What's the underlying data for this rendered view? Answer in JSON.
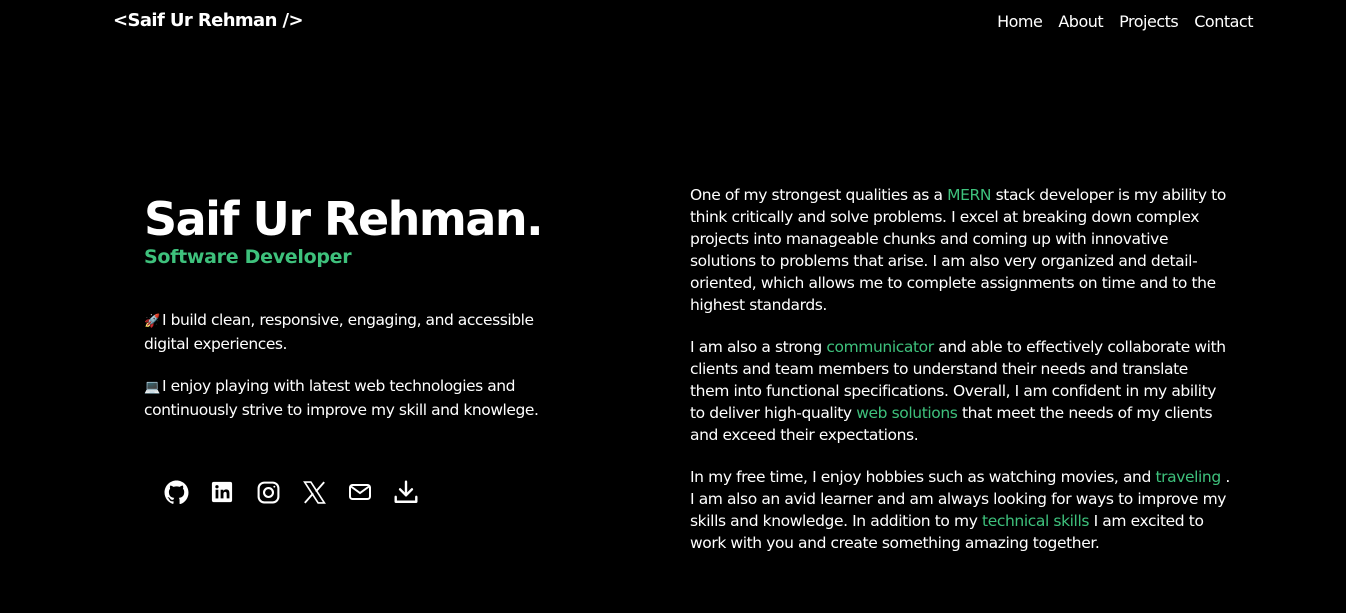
{
  "nav": {
    "brand": "<Saif Ur Rehman />",
    "links": [
      "Home",
      "About",
      "Projects",
      "Contact"
    ]
  },
  "hero": {
    "name": "Saif Ur Rehman.",
    "role": "Software Developer",
    "line1_emoji": "🚀",
    "line1": "I build clean, responsive, engaging, and accessible digital experiences.",
    "line2_emoji": "💻",
    "line2": "I enjoy playing with latest web technologies and continuously strive to improve my skill and knowlege."
  },
  "socials": {
    "icons": [
      "github-icon",
      "linkedin-icon",
      "instagram-icon",
      "x-icon",
      "mail-icon",
      "download-icon"
    ]
  },
  "about": {
    "p1": {
      "before": "One of my strongest qualities as a ",
      "highlight": "MERN",
      "after": " stack developer is my ability to think critically and solve problems. I excel at breaking down complex projects into manageable chunks and coming up with innovative solutions to problems that arise. I am also very organized and detail-oriented, which allows me to complete assignments on time and to the highest standards."
    },
    "p2": {
      "before": "I am also a strong ",
      "highlight1": "communicator",
      "middle": " and able to effectively collaborate with clients and team members to understand their needs and translate them into functional specifications. Overall, I am confident in my ability to deliver high-quality ",
      "highlight2": "web solutions",
      "after": " that meet the needs of my clients and exceed their expectations."
    },
    "p3": {
      "before": "In my free time, I enjoy hobbies such as watching movies, and ",
      "highlight1": "traveling",
      "middle": " . I am also an avid learner and am always looking for ways to improve my skills and knowledge. In addition to my ",
      "highlight2": "technical skills",
      "after": " I am excited to work with you and create something amazing together."
    }
  },
  "colors": {
    "background": "#000000",
    "text": "#ffffff",
    "accent": "#3ec17c"
  }
}
